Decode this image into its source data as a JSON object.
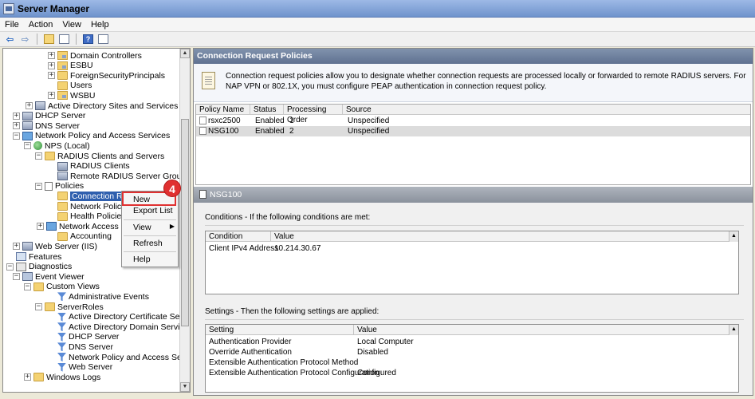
{
  "window": {
    "title": "Server Manager"
  },
  "menu": [
    "File",
    "Action",
    "View",
    "Help"
  ],
  "tree": [
    {
      "label": "Domain Controllers",
      "icon": "ou-icon",
      "exp": "+"
    },
    {
      "label": "ESBU",
      "icon": "ou-icon",
      "exp": "+"
    },
    {
      "label": "ForeignSecurityPrincipals",
      "icon": "folder-icon",
      "exp": "+"
    },
    {
      "label": "Users",
      "icon": "folder-icon",
      "exp": ""
    },
    {
      "label": "WSBU",
      "icon": "ou-icon",
      "exp": "+"
    },
    {
      "label": "Active Directory Sites and Services",
      "icon": "server-icon",
      "exp": "+"
    },
    {
      "label": "DHCP Server",
      "icon": "server-icon",
      "exp": "+"
    },
    {
      "label": "DNS Server",
      "icon": "server-icon",
      "exp": "+"
    },
    {
      "label": "Network Policy and Access Services",
      "icon": "network-icon",
      "exp": "−"
    },
    {
      "label": "NPS (Local)",
      "icon": "globe-icon",
      "exp": "−"
    },
    {
      "label": "RADIUS Clients and Servers",
      "icon": "folder-icon",
      "exp": "−"
    },
    {
      "label": "RADIUS Clients",
      "icon": "server-icon",
      "exp": ""
    },
    {
      "label": "Remote RADIUS Server Groups",
      "icon": "server-icon",
      "exp": ""
    },
    {
      "label": "Policies",
      "icon": "doc-icon",
      "exp": "−"
    },
    {
      "label": "Connection Requ",
      "icon": "folder-icon",
      "exp": ""
    },
    {
      "label": "Network Policies",
      "icon": "folder-icon",
      "exp": ""
    },
    {
      "label": "Health Policies",
      "icon": "folder-icon",
      "exp": ""
    },
    {
      "label": "Network Access Prote",
      "icon": "network-icon",
      "exp": "+"
    },
    {
      "label": "Accounting",
      "icon": "folder-icon",
      "exp": ""
    },
    {
      "label": "Web Server (IIS)",
      "icon": "server-icon",
      "exp": "+"
    },
    {
      "label": "Features",
      "icon": "features-icon",
      "exp": ""
    },
    {
      "label": "Diagnostics",
      "icon": "diagnostics-icon",
      "exp": "−"
    },
    {
      "label": "Event Viewer",
      "icon": "log-icon",
      "exp": "−"
    },
    {
      "label": "Custom Views",
      "icon": "folder-icon",
      "exp": "−"
    },
    {
      "label": "Administrative Events",
      "icon": "filter-icon",
      "exp": ""
    },
    {
      "label": "ServerRoles",
      "icon": "folder-icon",
      "exp": "−"
    },
    {
      "label": "Active Directory Certificate Services",
      "icon": "filter-icon",
      "exp": ""
    },
    {
      "label": "Active Directory Domain Services",
      "icon": "filter-icon",
      "exp": ""
    },
    {
      "label": "DHCP Server",
      "icon": "filter-icon",
      "exp": ""
    },
    {
      "label": "DNS Server",
      "icon": "filter-icon",
      "exp": ""
    },
    {
      "label": "Network Policy and Access Services",
      "icon": "filter-icon",
      "exp": ""
    },
    {
      "label": "Web Server",
      "icon": "filter-icon",
      "exp": ""
    },
    {
      "label": "Windows Logs",
      "icon": "folder-icon",
      "exp": "+"
    }
  ],
  "context_menu": {
    "new": "New",
    "export": "Export List",
    "view": "View",
    "refresh": "Refresh",
    "help": "Help",
    "step": "4"
  },
  "panel": {
    "header": "Connection Request Policies",
    "description": "Connection request policies allow you to designate whether connection requests are processed locally or forwarded to remote RADIUS servers. For NAP VPN or 802.1X, you must configure PEAP authentication in connection request policy.",
    "columns": [
      "Policy Name",
      "Status",
      "Processing Order",
      "Source"
    ],
    "rows": [
      {
        "name": "rsxc2500",
        "status": "Enabled",
        "order": "1",
        "source": "Unspecified"
      },
      {
        "name": "NSG100",
        "status": "Enabled",
        "order": "2",
        "source": "Unspecified"
      }
    ]
  },
  "details": {
    "title": "NSG100",
    "conditions_label": "Conditions - If the following conditions are met:",
    "conditions_cols": [
      "Condition",
      "Value"
    ],
    "conditions": [
      {
        "k": "Client IPv4 Address",
        "v": "10.214.30.67"
      }
    ],
    "settings_label": "Settings - Then the following settings are applied:",
    "settings_cols": [
      "Setting",
      "Value"
    ],
    "settings": [
      {
        "k": "Authentication Provider",
        "v": "Local Computer"
      },
      {
        "k": "Override Authentication",
        "v": "Disabled"
      },
      {
        "k": "Extensible Authentication Protocol Method",
        "v": ""
      },
      {
        "k": "Extensible Authentication Protocol Configuration",
        "v": "Configured"
      }
    ]
  }
}
